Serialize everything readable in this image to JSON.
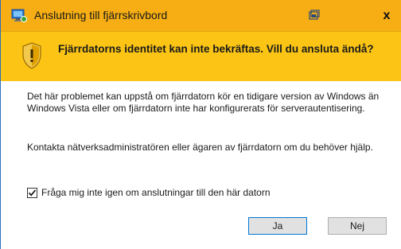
{
  "window": {
    "title": "Anslutning till fjärrskrivbord",
    "accent_color": "#f6ae14",
    "banner_color": "#fcc515",
    "icons": [
      "remote-desktop-icon",
      "restore-icon",
      "close-icon",
      "warning-shield-icon",
      "check-icon"
    ]
  },
  "banner": {
    "message": "Fjärrdatorns identitet kan inte bekräftas. Vill du ansluta ändå?"
  },
  "body": {
    "paragraph1": "Det här problemet kan uppstå om fjärrdatorn kör en tidigare version av Windows än Windows Vista eller om fjärrdatorn inte har konfigurerats för serverautentisering.",
    "paragraph2": "Kontakta nätverksadministratören eller ägaren av fjärrdatorn om du behöver hjälp."
  },
  "checkbox": {
    "label": "Fråga mig inte igen om anslutningar till den här datorn",
    "checked": true
  },
  "buttons": {
    "close_label": "x",
    "yes_label": "Ja",
    "no_label": "Nej"
  }
}
